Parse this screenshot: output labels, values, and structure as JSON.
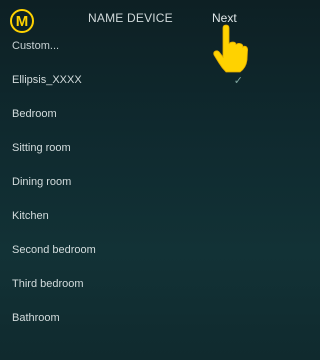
{
  "header": {
    "logo_letter": "M",
    "title": "NAME DEVICE",
    "next_label": "Next"
  },
  "list": {
    "items": [
      {
        "label": "Custom..."
      },
      {
        "label": "Ellipsis_XXXX",
        "selected": true
      },
      {
        "label": "Bedroom"
      },
      {
        "label": "Sitting room"
      },
      {
        "label": "Dining room"
      },
      {
        "label": "Kitchen"
      },
      {
        "label": "Second bedroom"
      },
      {
        "label": "Third bedroom"
      },
      {
        "label": "Bathroom"
      }
    ],
    "check_glyph": "✓"
  },
  "colors": {
    "accent": "#ffd200",
    "background_top": "#0d2024",
    "background_bottom": "#123236",
    "check": "#7fa6a0"
  },
  "icons": {
    "logo": "m-logo-icon",
    "pointer": "hand-pointer-icon",
    "check": "checkmark-icon"
  }
}
